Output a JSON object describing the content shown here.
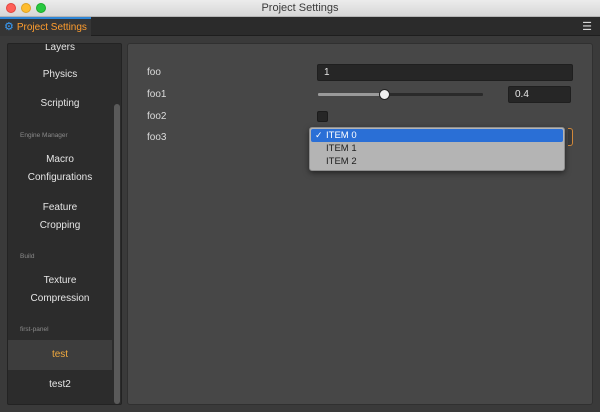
{
  "window": {
    "title": "Project Settings"
  },
  "tab": {
    "label": "Project Settings",
    "icon": "gear-icon",
    "accent": "#2f86d6",
    "label_color": "#ff9d2e"
  },
  "sidebar": {
    "items": [
      {
        "kind": "item",
        "label": "Layers"
      },
      {
        "kind": "item",
        "label": "Physics"
      },
      {
        "kind": "item",
        "label": "Scripting"
      },
      {
        "kind": "section",
        "label": "Engine Manager"
      },
      {
        "kind": "item",
        "label": "Macro\nConfigurations"
      },
      {
        "kind": "item",
        "label": "Feature\nCropping"
      },
      {
        "kind": "section",
        "label": "Build"
      },
      {
        "kind": "item",
        "label": "Texture\nCompression"
      },
      {
        "kind": "section",
        "label": "first-panel"
      },
      {
        "kind": "item",
        "label": "test",
        "active": true
      },
      {
        "kind": "item",
        "label": "test2"
      }
    ]
  },
  "form": {
    "foo": {
      "label": "foo",
      "value": "1"
    },
    "foo1": {
      "label": "foo1",
      "value": "0.4",
      "slider_fraction": 0.4
    },
    "foo2": {
      "label": "foo2",
      "checked": false
    },
    "foo3": {
      "label": "foo3",
      "options": [
        "ITEM 0",
        "ITEM 1",
        "ITEM 2"
      ],
      "selected": "ITEM 0",
      "check_glyph": "✓"
    }
  }
}
